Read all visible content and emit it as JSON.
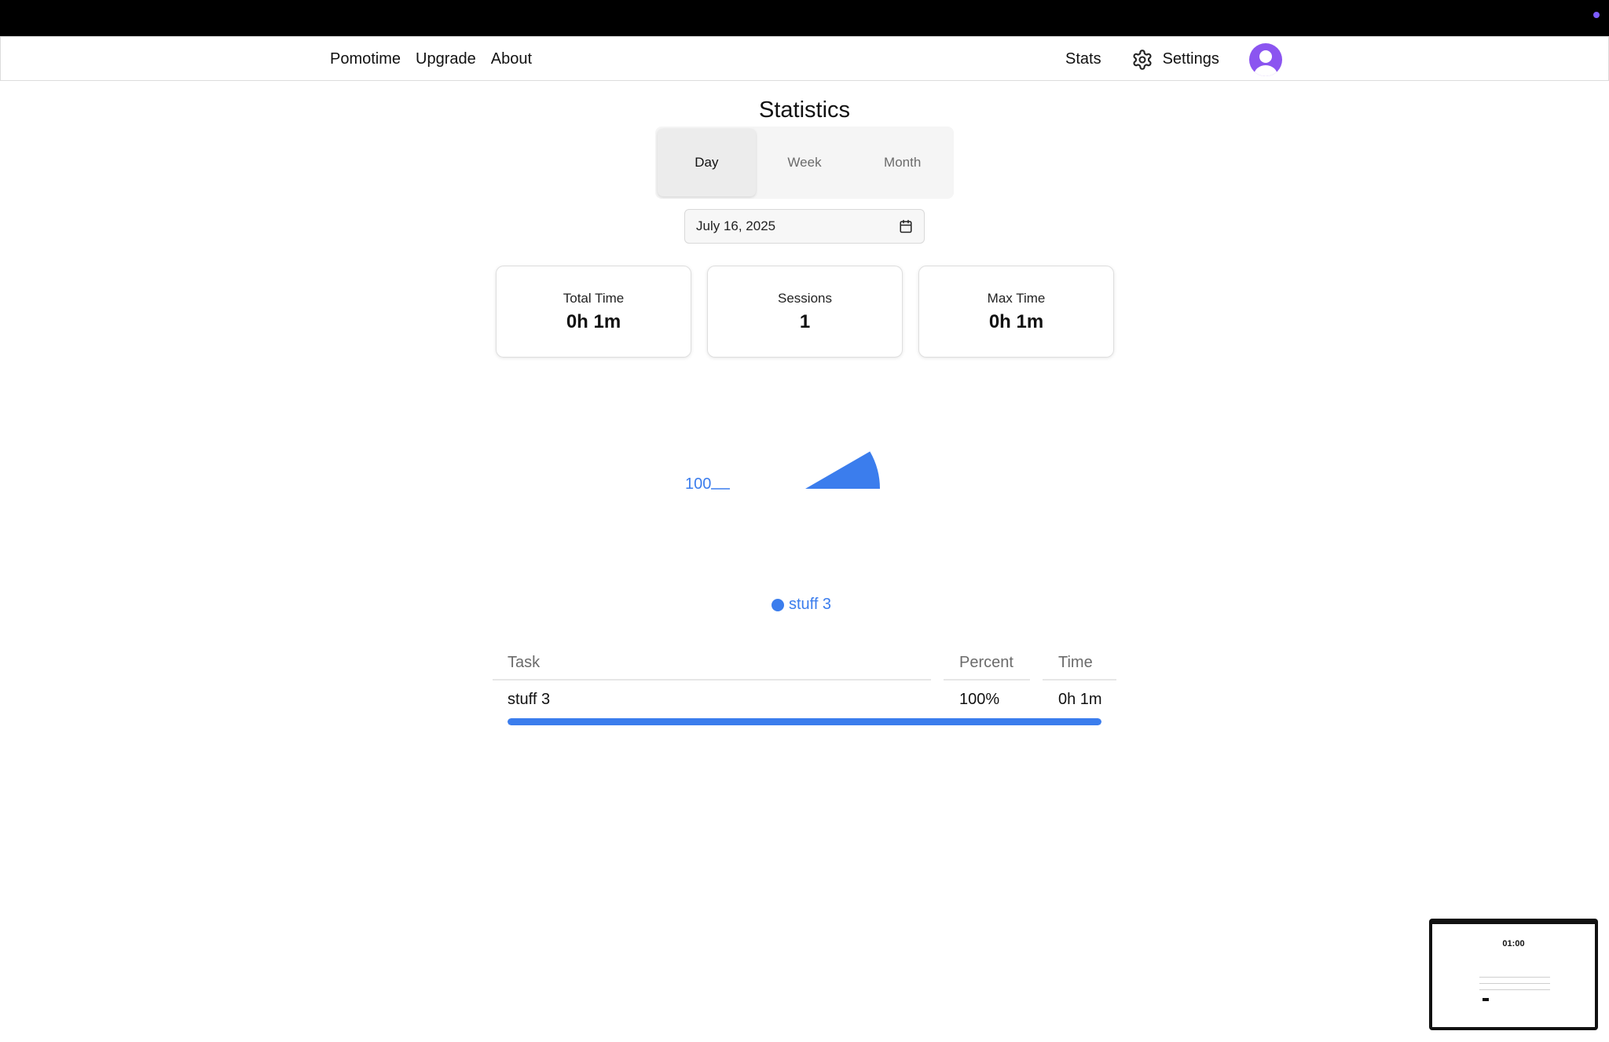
{
  "nav": {
    "left": [
      "Pomotime",
      "Upgrade",
      "About"
    ],
    "stats": "Stats",
    "settings": "Settings"
  },
  "page": {
    "title": "Statistics",
    "tabs": [
      "Day",
      "Week",
      "Month"
    ],
    "active_tab": "Day",
    "date": "July 16, 2025"
  },
  "cards": [
    {
      "label": "Total Time",
      "value": "0h 1m"
    },
    {
      "label": "Sessions",
      "value": "1"
    },
    {
      "label": "Max Time",
      "value": "0h 1m"
    }
  ],
  "chart_data": {
    "type": "pie",
    "slices": [
      {
        "label": "stuff 3",
        "value": 100,
        "color": "#3b7ded"
      }
    ],
    "data_label": "100",
    "legend": [
      "stuff 3"
    ]
  },
  "table": {
    "headers": {
      "task": "Task",
      "percent": "Percent",
      "time": "Time"
    },
    "rows": [
      {
        "task": "stuff 3",
        "percent": "100%",
        "time": "0h 1m",
        "fraction": 1.0
      }
    ]
  },
  "thumbnail": {
    "time": "01:00"
  },
  "colors": {
    "accent": "#3b7ded",
    "avatar": "#8b55f0"
  }
}
